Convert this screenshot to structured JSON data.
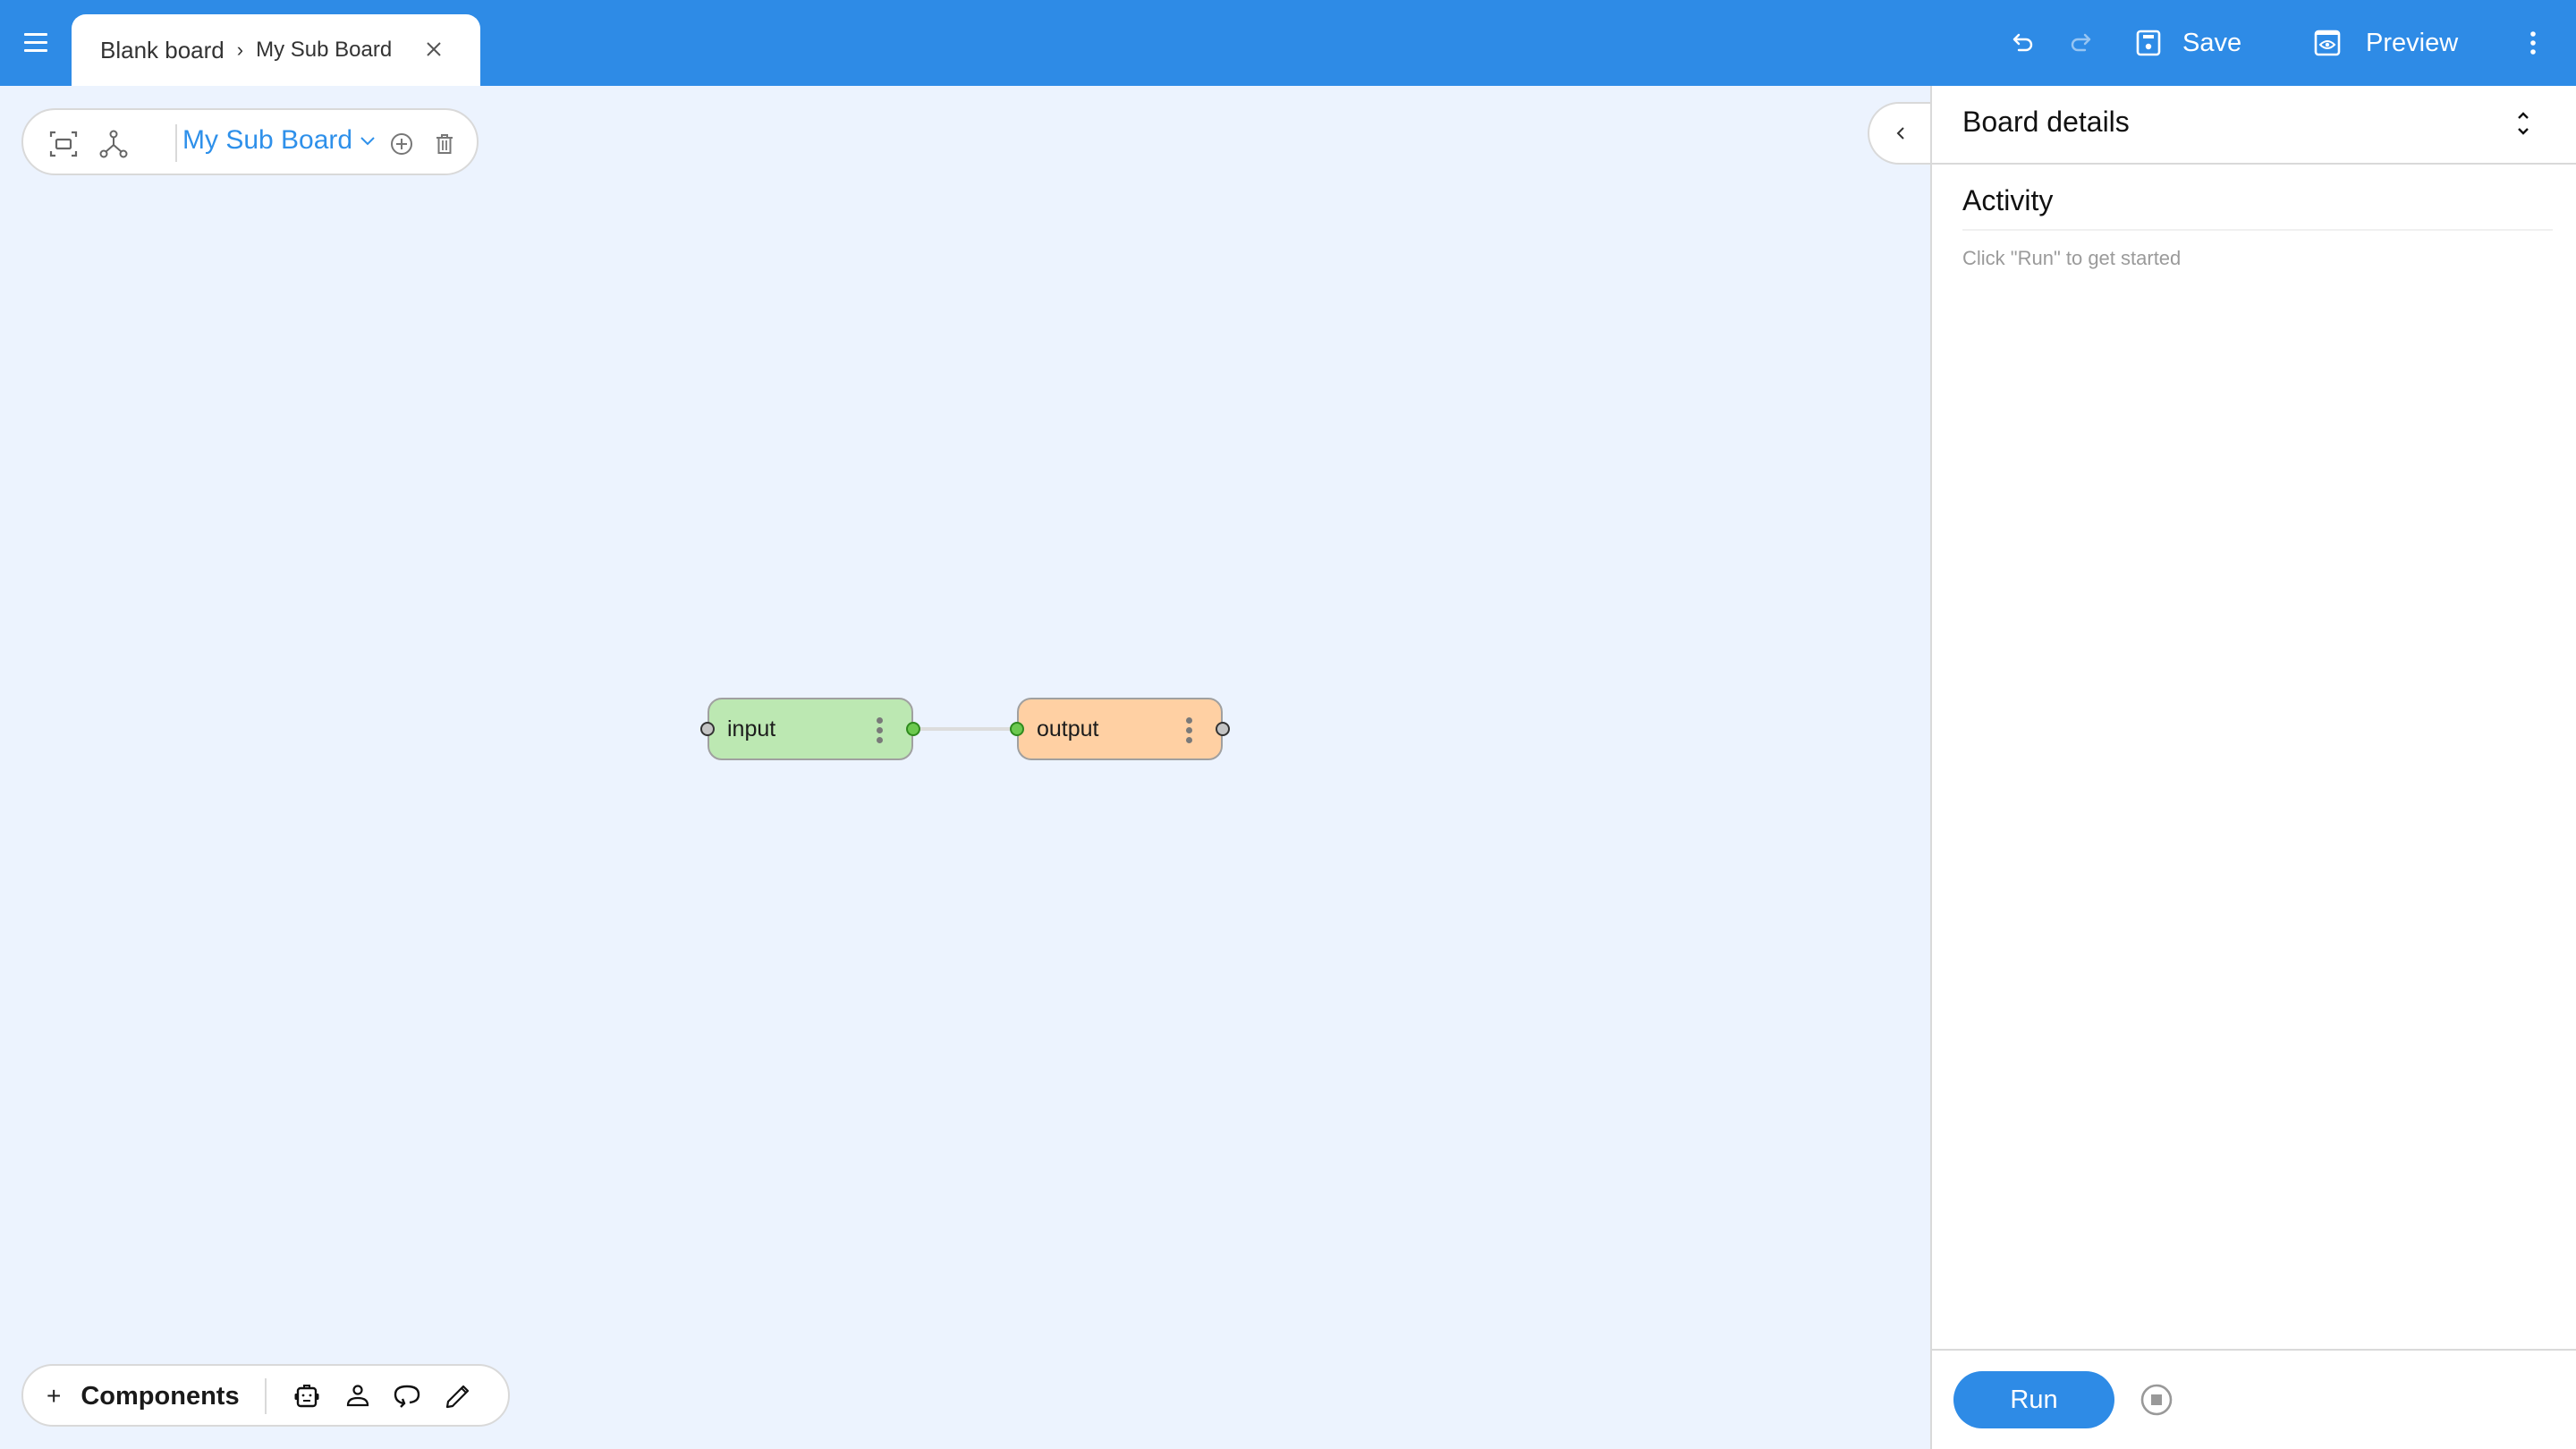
{
  "header": {
    "menu_icon": "hamburger-menu-icon",
    "breadcrumb": {
      "root": "Blank board",
      "separator": "›",
      "current": "My Sub Board"
    },
    "tab_close_icon": "close-icon",
    "actions": {
      "undo_icon": "undo-icon",
      "redo_icon": "redo-icon",
      "redo_enabled": false,
      "save_label": "Save",
      "save_icon": "floppy-disk-icon",
      "preview_label": "Preview",
      "preview_icon": "eye-window-icon",
      "more_icon": "more-vertical-icon"
    },
    "background_color": "#2e8be6"
  },
  "toolbar": {
    "fit_icon": "fit-to-screen-icon",
    "layout_icon": "graph-layout-icon",
    "board_selector": "My Sub Board",
    "board_selector_icon": "chevron-down-icon",
    "add_icon": "add-circle-icon",
    "delete_icon": "trash-icon",
    "accent_color": "#2e90ea"
  },
  "canvas": {
    "nodes": [
      {
        "id": "input",
        "label": "input",
        "color": "#bce8b2"
      },
      {
        "id": "output",
        "label": "output",
        "color": "#ffd0a3"
      }
    ],
    "edges": [
      {
        "from": "input",
        "to": "output"
      }
    ],
    "background_color": "#ecf3fe"
  },
  "component_bar": {
    "add_label": "Components",
    "add_icon": "plus-icon",
    "tools": [
      {
        "name": "robot-icon"
      },
      {
        "name": "person-icon"
      },
      {
        "name": "loop-icon"
      },
      {
        "name": "pencil-icon"
      }
    ]
  },
  "panel": {
    "collapse_icon": "chevron-left-icon",
    "title": "Board details",
    "title_toggle_icon": "expand-collapse-icon",
    "activity": {
      "heading": "Activity",
      "empty_message": "Click \"Run\" to get started"
    },
    "footer": {
      "run_label": "Run",
      "stop_icon": "stop-circle-icon"
    }
  }
}
